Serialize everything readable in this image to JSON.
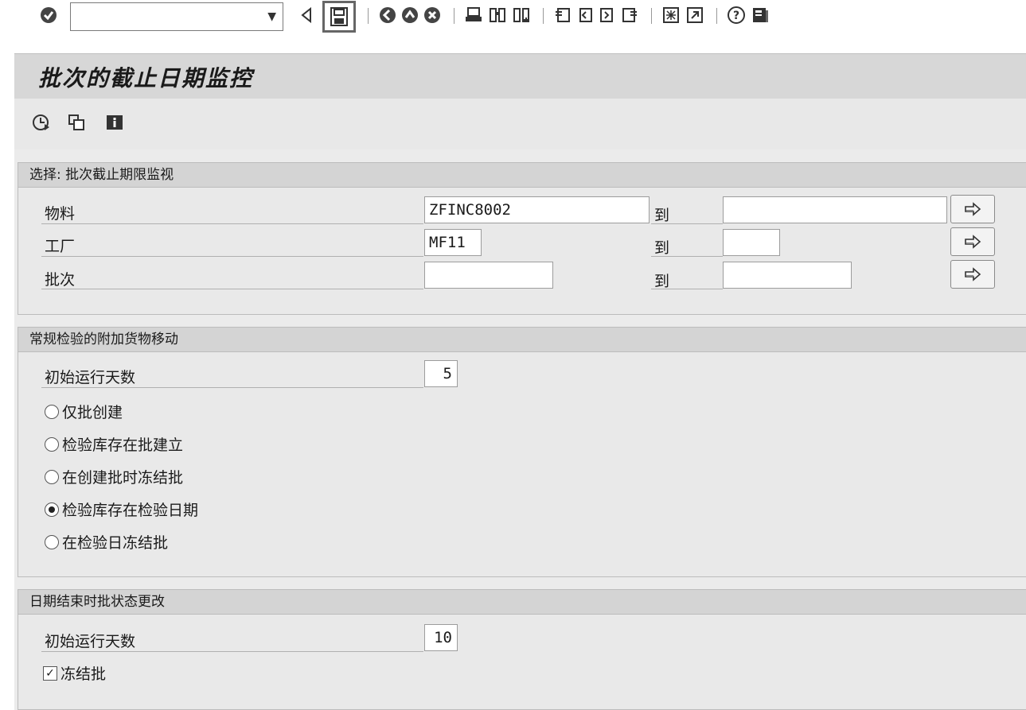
{
  "toolbar": {
    "command_field_value": "",
    "icons": [
      "enter-icon",
      "back-arrow-icon",
      "save-icon",
      "back-icon",
      "exit-icon",
      "cancel-icon",
      "print-icon",
      "find-icon",
      "find-next-icon",
      "first-page-icon",
      "previous-page-icon",
      "next-page-icon",
      "last-page-icon",
      "create-session-icon",
      "shortcut-icon",
      "help-icon",
      "layout-menu-icon"
    ]
  },
  "title": "批次的截止日期监控",
  "app_toolbar": {
    "icons": [
      "execute-icon",
      "copy-icon",
      "info-icon"
    ]
  },
  "section1": {
    "heading": "选择: 批次截止期限监视",
    "rows": [
      {
        "label": "物料",
        "from": "ZFINC8002",
        "to_label": "到",
        "to": ""
      },
      {
        "label": "工厂",
        "from": "MF11",
        "to_label": "到",
        "to": ""
      },
      {
        "label": "批次",
        "from": "",
        "to_label": "到",
        "to": ""
      }
    ]
  },
  "section2": {
    "heading": "常规检验的附加货物移动",
    "days_label": "初始运行天数",
    "days_value": "5",
    "options": [
      {
        "label": "仅批创建",
        "selected": false
      },
      {
        "label": "检验库存在批建立",
        "selected": false
      },
      {
        "label": "在创建批时冻结批",
        "selected": false
      },
      {
        "label": "检验库存在检验日期",
        "selected": true
      },
      {
        "label": "在检验日冻结批",
        "selected": false
      }
    ]
  },
  "section3": {
    "heading": "日期结束时批状态更改",
    "days_label": "初始运行天数",
    "days_value": "10",
    "checkbox_label": "冻结批",
    "checkbox_checked": true
  }
}
